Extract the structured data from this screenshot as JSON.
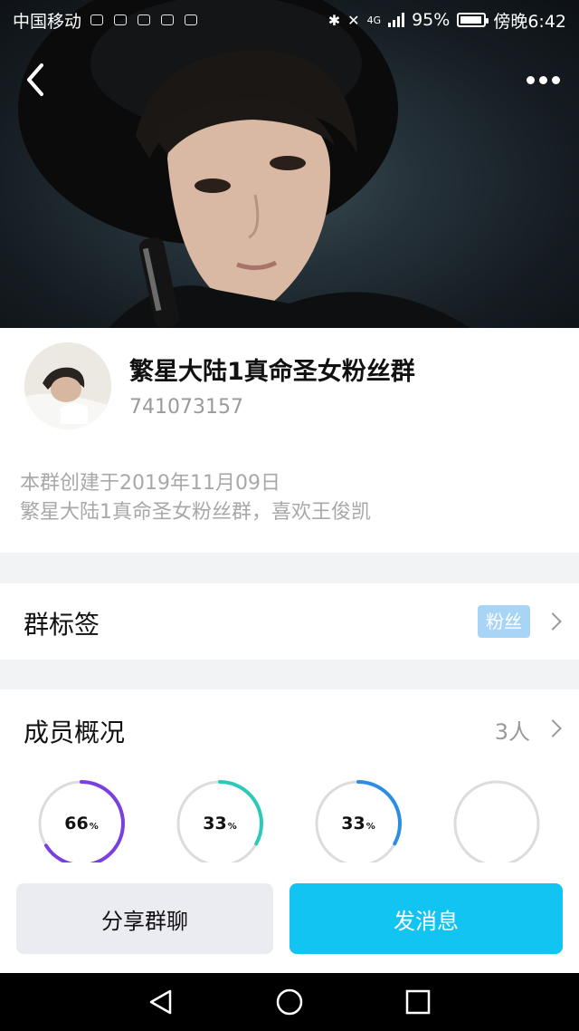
{
  "status_bar": {
    "carrier": "中国移动",
    "network": "4G",
    "battery_percent": "95%",
    "battery_level": 0.95,
    "time": "傍晚6:42",
    "icons": [
      "bluetooth-icon",
      "mute-icon",
      "signal-icon",
      "battery-icon"
    ]
  },
  "header": {
    "back_icon": "chevron-left-icon",
    "more_icon": "more-dots-icon"
  },
  "group": {
    "name": "繁星大陆1真命圣女粉丝群",
    "id": "741073157",
    "created": "本群创建于2019年11月09日",
    "description": "繁星大陆1真命圣女粉丝群，喜欢王俊凯"
  },
  "tags_row": {
    "label": "群标签",
    "tag": "粉丝",
    "tag_color": "#a8d4f5"
  },
  "members_row": {
    "label": "成员概况",
    "count": "3人",
    "rings": [
      {
        "value": "66",
        "unit": "%",
        "fraction": 0.66,
        "color": "#7b3fe0"
      },
      {
        "value": "33",
        "unit": "%",
        "fraction": 0.33,
        "color": "#2cc9b8"
      },
      {
        "value": "33",
        "unit": "%",
        "fraction": 0.33,
        "color": "#2d8de3"
      },
      {
        "value": "",
        "unit": "",
        "fraction": 0,
        "color": "#dcdcdc"
      }
    ]
  },
  "actions": {
    "share_label": "分享群聊",
    "send_label": "发消息",
    "accent_color": "#12c4f2"
  },
  "system_nav": {
    "back": "nav-back-triangle-icon",
    "home": "nav-home-circle-icon",
    "recents": "nav-recents-square-icon"
  }
}
